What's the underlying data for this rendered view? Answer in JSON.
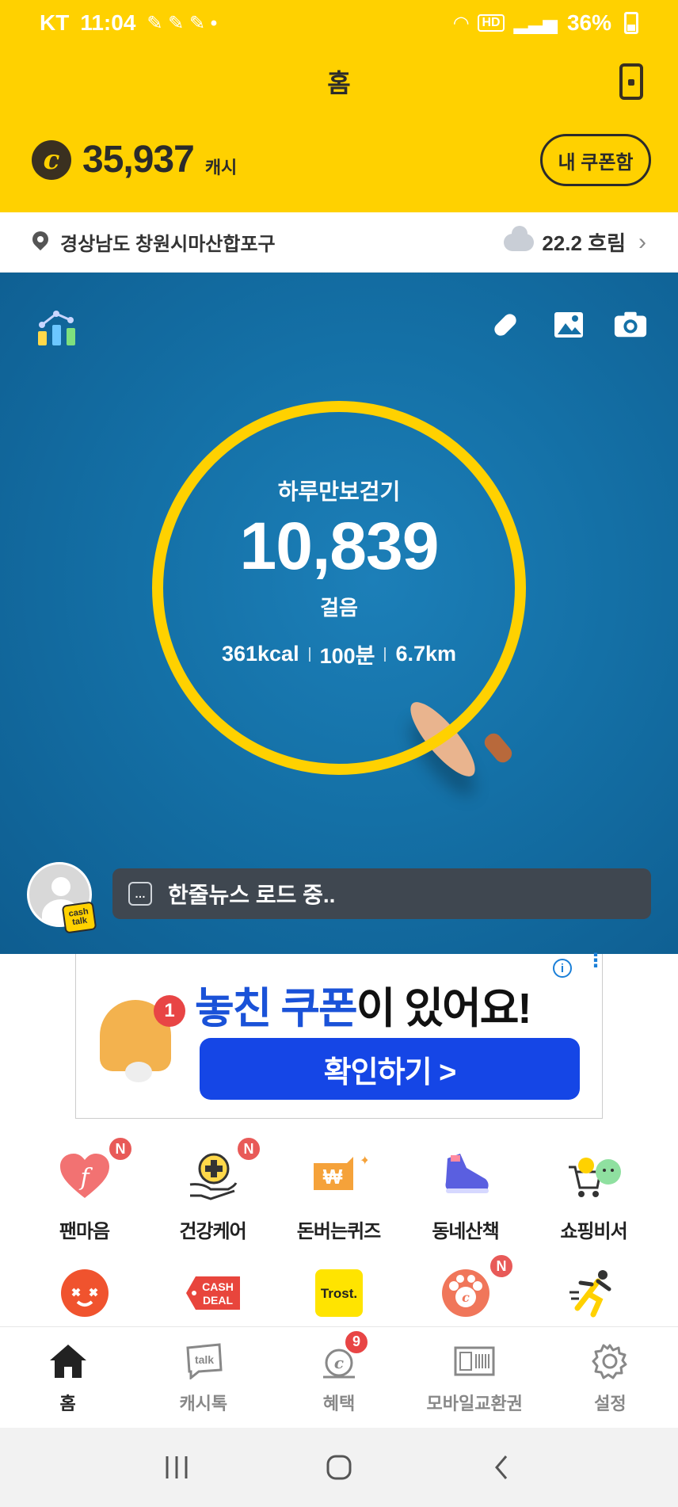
{
  "status_bar": {
    "carrier": "KT",
    "time": "11:04",
    "hd": "HD",
    "battery": "36%"
  },
  "header": {
    "title": "홈",
    "cash_amount": "35,937",
    "cash_unit": "캐시",
    "coupon_button": "내 쿠폰함",
    "coin_symbol": "c"
  },
  "location": {
    "place": "경상남도 창원시마산합포구",
    "weather": "22.2 흐림"
  },
  "walking": {
    "title": "하루만보걷기",
    "steps": "10,839",
    "unit": "걸음",
    "kcal": "361kcal",
    "minutes": "100분",
    "distance": "6.7km"
  },
  "news": {
    "text": "한줄뉴스 로드 중..",
    "badge_line1": "cash",
    "badge_line2": "talk"
  },
  "ad": {
    "headline_part1": "놓친 쿠폰",
    "headline_part2": "이 있어요!",
    "cta": "확인하기 >",
    "bell_badge": "1"
  },
  "grid": {
    "row1": [
      {
        "label": "팬마음",
        "icon": "fan-heart-icon",
        "badge": "N"
      },
      {
        "label": "건강케어",
        "icon": "health-care-icon",
        "badge": "N"
      },
      {
        "label": "돈버는퀴즈",
        "icon": "quiz-icon",
        "badge": ""
      },
      {
        "label": "동네산책",
        "icon": "sneaker-icon",
        "badge": ""
      },
      {
        "label": "쇼핑비서",
        "icon": "shopping-cart-icon",
        "badge": ""
      }
    ],
    "row2": [
      {
        "icon": "orange-face-icon",
        "badge": ""
      },
      {
        "icon": "cash-deal-icon",
        "text": "CASH DEAL",
        "badge": ""
      },
      {
        "icon": "trost-icon",
        "text": "Trost.",
        "badge": ""
      },
      {
        "icon": "paw-coin-icon",
        "badge": "N"
      },
      {
        "icon": "runner-icon",
        "badge": ""
      }
    ]
  },
  "bottom_nav": [
    {
      "label": "홈",
      "icon": "home-icon"
    },
    {
      "label": "캐시톡",
      "icon": "cashtalk-icon"
    },
    {
      "label": "혜택",
      "icon": "benefit-icon",
      "badge": "9"
    },
    {
      "label": "모바일교환권",
      "icon": "voucher-icon"
    },
    {
      "label": "설정",
      "icon": "settings-icon"
    }
  ],
  "colors": {
    "brand_yellow": "#FFD100",
    "hero_blue": "#1470a6",
    "cta_blue": "#1546e6",
    "badge_red": "#e85a58"
  }
}
